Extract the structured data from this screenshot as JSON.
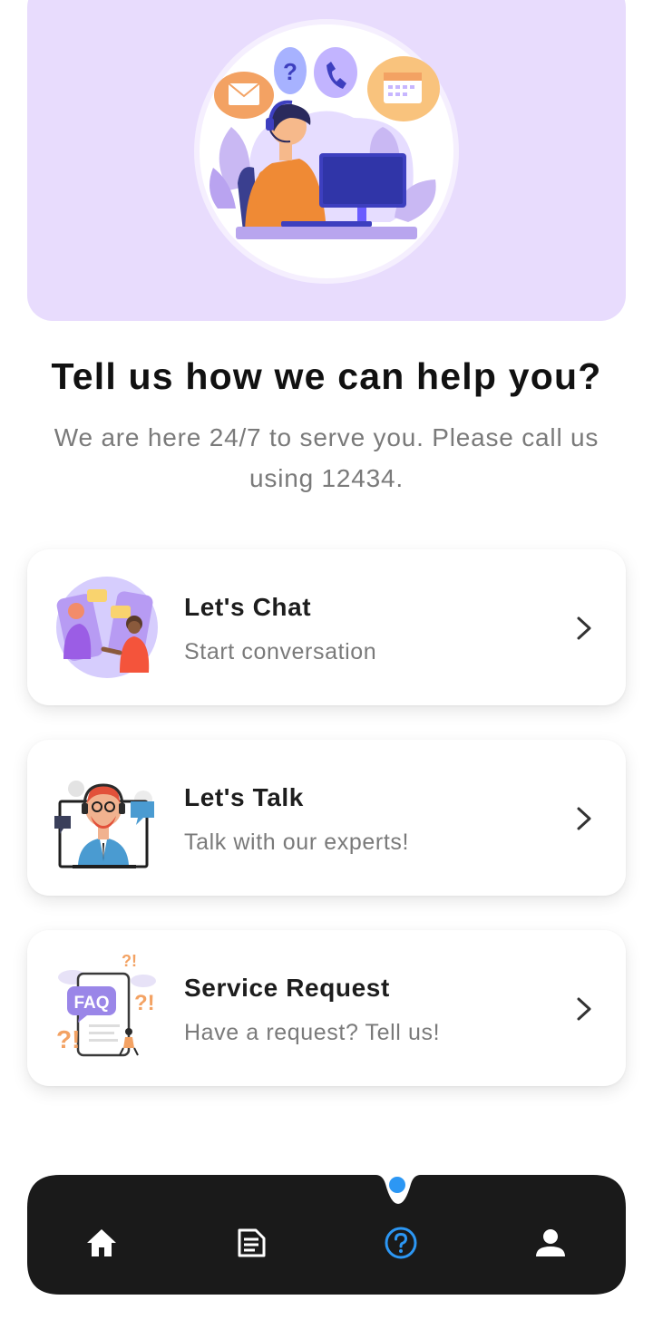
{
  "hero": {
    "background": "#e8dcfd",
    "illustration": "customer-support-agent-illustration"
  },
  "headline": "Tell us how we can help you?",
  "subtext": "We are here 24/7 to serve you. Please call us using 12434.",
  "options": [
    {
      "title": "Let's Chat",
      "subtitle": "Start conversation",
      "illustration": "chat-illustration",
      "icon": "chevron-right-icon"
    },
    {
      "title": "Let's Talk",
      "subtitle": "Talk with our experts!",
      "illustration": "talk-illustration",
      "icon": "chevron-right-icon"
    },
    {
      "title": "Service Request",
      "subtitle": "Have a request? Tell us!",
      "illustration": "faq-illustration",
      "icon": "chevron-right-icon"
    }
  ],
  "bottom_nav": {
    "background": "#1a1a1a",
    "active_color": "#2c97f4",
    "items": [
      {
        "name": "home",
        "icon": "home-icon",
        "active": false
      },
      {
        "name": "documents",
        "icon": "document-icon",
        "active": false
      },
      {
        "name": "help",
        "icon": "help-icon",
        "active": true
      },
      {
        "name": "profile",
        "icon": "person-icon",
        "active": false
      }
    ]
  }
}
